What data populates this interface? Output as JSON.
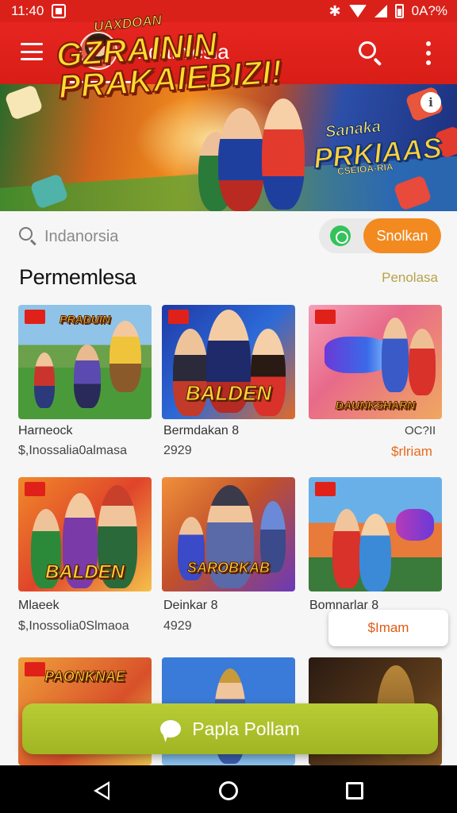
{
  "status_bar": {
    "time": "11:40",
    "bluetooth": "✱",
    "battery_text": "0A?%",
    "icons": [
      "photo-icon",
      "bluetooth-icon",
      "wifi-icon",
      "signal-icon",
      "battery-icon"
    ]
  },
  "app_bar": {
    "title": "Indaınlesia",
    "menu_icon": "hamburger-icon",
    "search_icon": "search-icon",
    "more_icon": "more-vertical-icon",
    "color": "#e0221b"
  },
  "banner": {
    "small_text": "UAXDOAN",
    "headline_line1": "GZRAININ",
    "headline_line2": "PRAKAIEBIZI!",
    "right_small": "Sanaka",
    "right_big": "PRKIAAS",
    "right_tiny": "CSEIOA-RIA",
    "info_label": "i"
  },
  "search": {
    "placeholder": "Indanorsia",
    "whatsapp_icon": "whatsapp-icon",
    "button_label": "Snolkan",
    "accent": "#f28a1f"
  },
  "section": {
    "title": "Permemlesa",
    "link": "Penolasa"
  },
  "games": [
    {
      "name": "Harneock",
      "meta": "$,Inossalia0almasa",
      "price": "",
      "logo": "PRADUIN",
      "art": "field"
    },
    {
      "name": "Bermdakan 8",
      "meta": "2929",
      "price": "",
      "logo": "BALDEN",
      "art": "heroes"
    },
    {
      "name": "",
      "meta": "",
      "code": "OC?II",
      "price": "$rlriam",
      "logo": "DAUNKSHARN",
      "art": "rocket"
    },
    {
      "name": "Mlaeek",
      "meta": "$,Inossolia0Slmaoa",
      "price": "",
      "logo": "BALDEN",
      "art": "team"
    },
    {
      "name": "Deinkar 8",
      "meta": "4929",
      "price": "",
      "logo": "SAROBKAB",
      "art": "robot"
    },
    {
      "name": "Bomnarlar 8",
      "meta": "",
      "price": "",
      "logo": "",
      "art": "blaster"
    },
    {
      "name": "",
      "meta": "",
      "price": "",
      "logo": "PAONKNAE",
      "art": "crowd"
    },
    {
      "name": "",
      "meta": "",
      "price": "",
      "logo": "",
      "art": "sky"
    },
    {
      "name": "",
      "meta": "",
      "price": "",
      "logo": "",
      "art": "dark"
    }
  ],
  "floating_price": "$Imam",
  "cta": {
    "label": "Papla Pollam",
    "icon": "chat-bubble-icon",
    "color": "#a9bd2a"
  },
  "nav_bar": {
    "icons": [
      "back-icon",
      "home-icon",
      "recents-icon"
    ]
  }
}
